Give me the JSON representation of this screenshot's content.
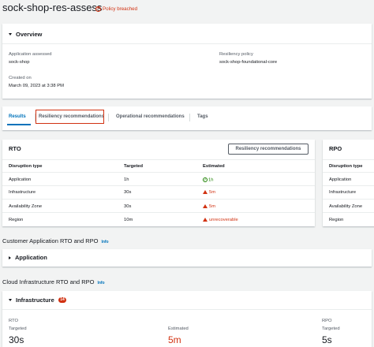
{
  "header": {
    "title": "sock-shop-res-assess",
    "status": "Policy breached"
  },
  "overview": {
    "heading": "Overview",
    "app_assessed_label": "Application assessed",
    "app_assessed_value": "sock-shop",
    "policy_label": "Resiliency policy",
    "policy_value": "sock-shop-foundational-core",
    "created_label": "Created on",
    "created_value": "March 09, 2023 at 3:38 PM"
  },
  "tabs": [
    {
      "label": "Results",
      "active": true
    },
    {
      "label": "Resiliency recommendations",
      "active": false
    },
    {
      "label": "Operational recommendations",
      "active": false
    },
    {
      "label": "Tags",
      "active": false
    }
  ],
  "rto": {
    "heading": "RTO",
    "button": "Resiliency recommendations",
    "columns": [
      "Disruption type",
      "Targeted",
      "Estimated"
    ],
    "rows": [
      {
        "type": "Application",
        "targeted": "1h",
        "estimated": "1h",
        "status": "ok"
      },
      {
        "type": "Infrastructure",
        "targeted": "30s",
        "estimated": "5m",
        "status": "breach"
      },
      {
        "type": "Availability Zone",
        "targeted": "30s",
        "estimated": "5m",
        "status": "breach"
      },
      {
        "type": "Region",
        "targeted": "10m",
        "estimated": "unrecoverable",
        "status": "breach"
      }
    ]
  },
  "rpo": {
    "heading": "RPO",
    "column": "Disruption type",
    "rows": [
      "Application",
      "Infrastructure",
      "Availability Zone",
      "Region"
    ]
  },
  "customer_section": {
    "heading": "Customer Application RTO and RPO",
    "info": "Info",
    "app_heading": "Application"
  },
  "infra_section": {
    "heading": "Cloud Infrastructure RTO and RPO",
    "info": "Info",
    "infra_heading": "Infrastructure",
    "badge": "14",
    "rto_label": "RTO",
    "targeted_label": "Targeted",
    "targeted_value": "30s",
    "estimated_label": "Estimated",
    "estimated_value": "5m",
    "rpo_label": "RPO",
    "rpo_targeted_label": "Targeted",
    "rpo_targeted_value": "5s"
  },
  "colors": {
    "accent": "#0073bb",
    "breach": "#d13212",
    "ok": "#1d8102"
  }
}
